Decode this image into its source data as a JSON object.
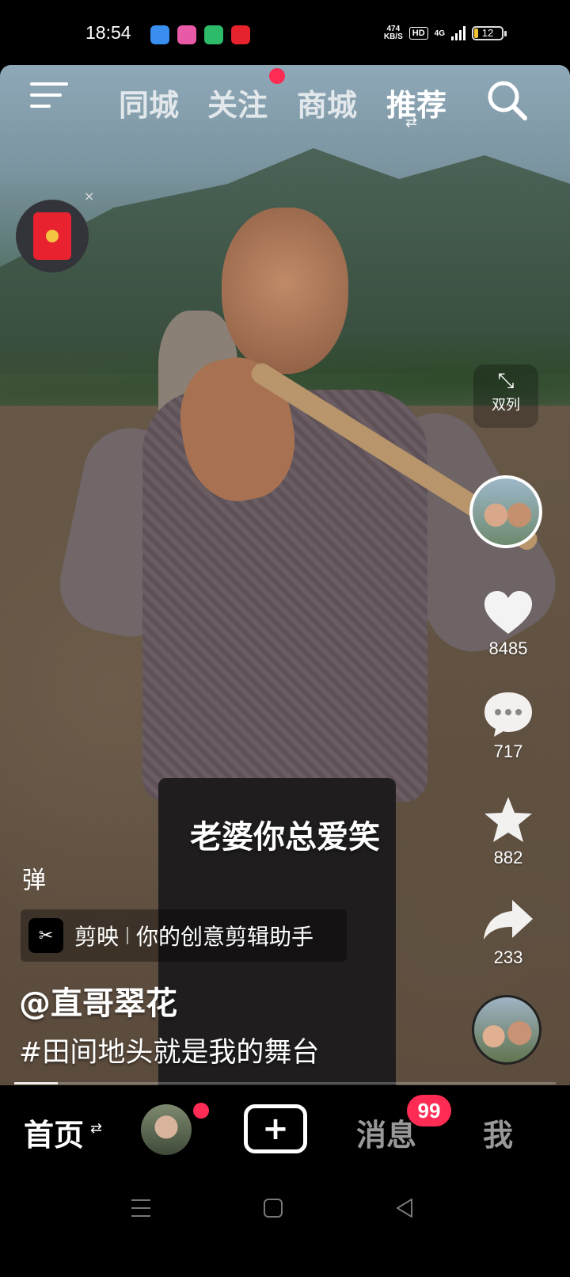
{
  "status_bar": {
    "time": "18:54",
    "net_speed_value": "474",
    "net_speed_unit": "KB/S",
    "hd_label": "HD",
    "network": "4G",
    "battery_level": "12"
  },
  "top_nav": {
    "tabs": [
      {
        "label": "同城"
      },
      {
        "label": "关注"
      },
      {
        "label": "商城"
      },
      {
        "label": "推荐"
      }
    ],
    "active_tab": "推荐",
    "follow_has_dot": true
  },
  "floating": {
    "close_label": "×",
    "dual_column_label": "双列"
  },
  "actions": {
    "like_count": "8485",
    "comment_count": "717",
    "favorite_count": "882",
    "share_count": "233"
  },
  "video": {
    "subtitle": "老婆你总爱笑",
    "danmu_label": "弹",
    "app_name": "剪映",
    "app_slogan": "你的创意剪辑助手",
    "author": "@直哥翠花",
    "caption": "#田间地头就是我的舞台",
    "progress_fraction": 0.08
  },
  "bottom_bar": {
    "home_label": "首页",
    "plus_label": "+",
    "messages_label": "消息",
    "messages_badge": "99",
    "me_label": "我"
  },
  "colors": {
    "accent": "#fe2c55",
    "background": "#000000"
  }
}
